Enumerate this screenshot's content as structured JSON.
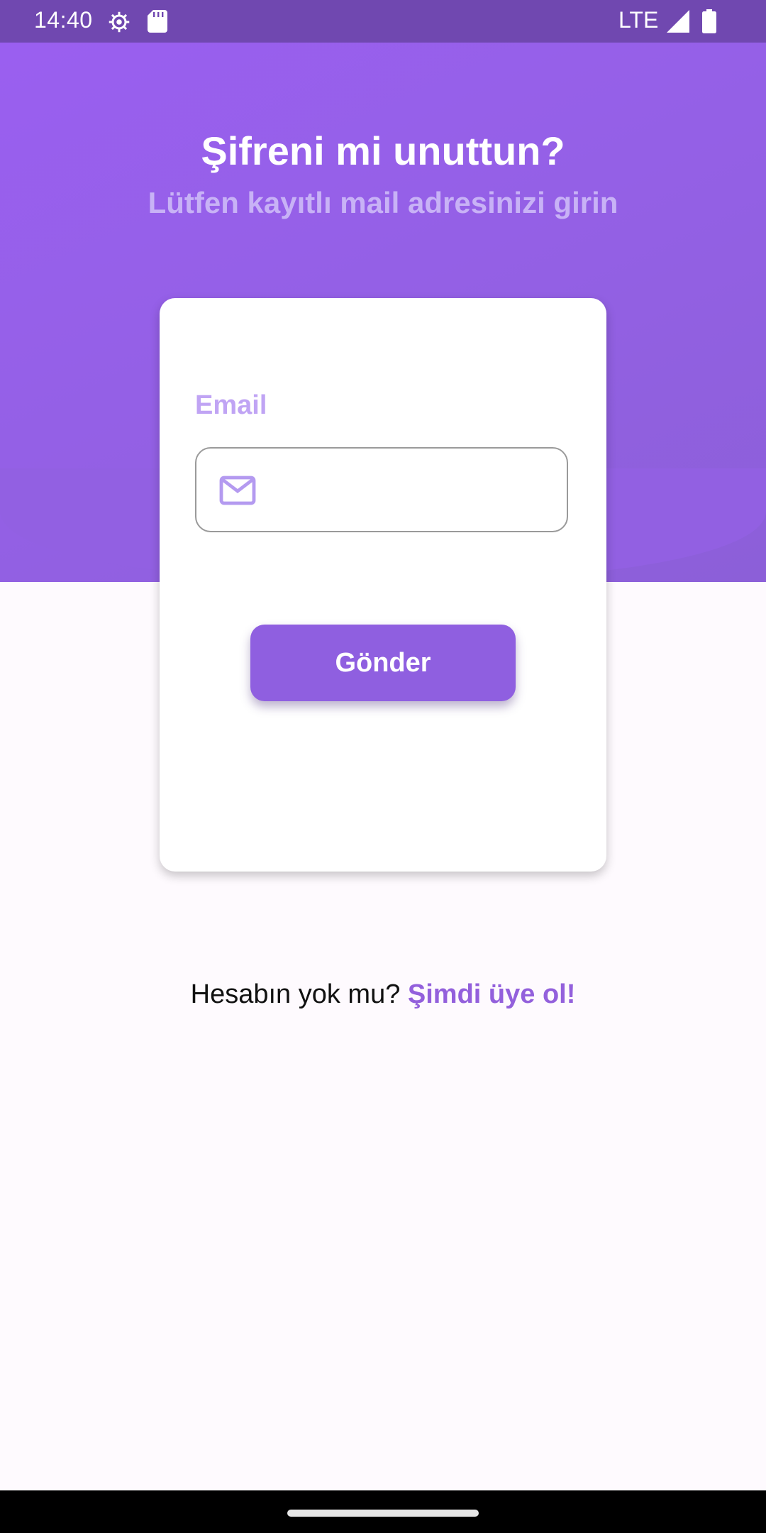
{
  "status_bar": {
    "time": "14:40",
    "network": "LTE",
    "icons": [
      "settings-gear-icon",
      "sd-card-icon",
      "signal-icon",
      "battery-icon"
    ]
  },
  "header": {
    "title": "Şifreni mi unuttun?",
    "subtitle": "Lütfen kayıtlı mail adresinizi girin"
  },
  "form": {
    "email_label": "Email",
    "email_value": "",
    "email_icon": "mail-icon",
    "submit_label": "Gönder"
  },
  "footer": {
    "question": "Hesabın yok mu?",
    "signup_link": "Şimdi üye ol!"
  },
  "colors": {
    "status_bar": "#7048b0",
    "header_gradient_start": "#9a5ff0",
    "header_gradient_end": "#8c5fd8",
    "accent": "#8f5fe0",
    "label": "#c0a4f4",
    "link": "#9360dc",
    "background": "#fefafe"
  }
}
